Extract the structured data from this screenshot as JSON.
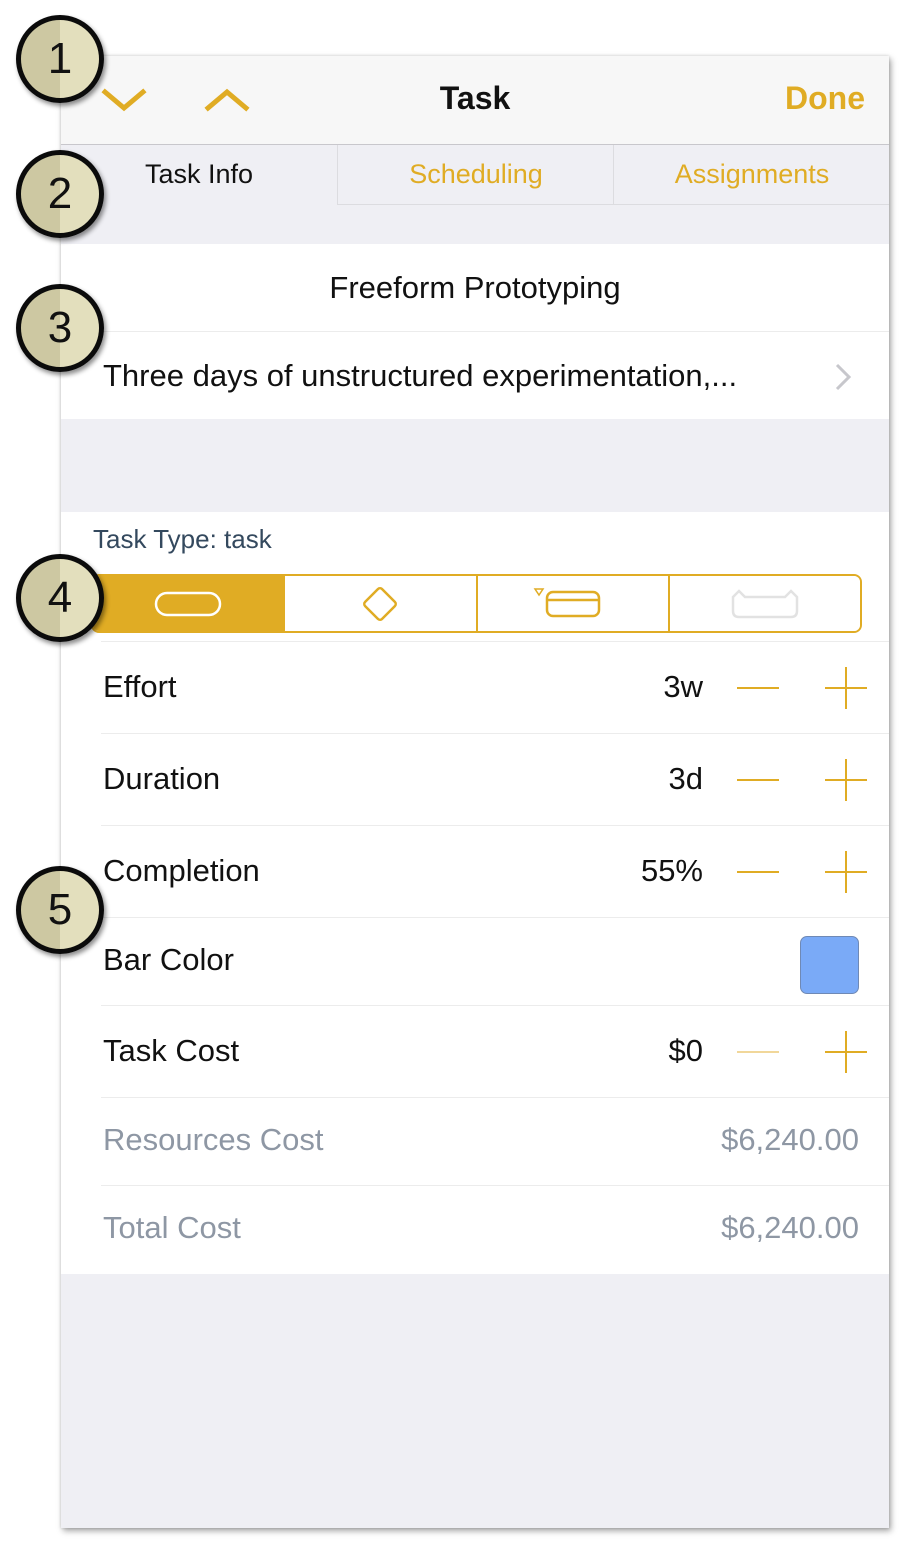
{
  "navbar": {
    "prev_icon": "chevron-down-icon",
    "next_icon": "chevron-up-icon",
    "title": "Task",
    "done_label": "Done"
  },
  "tabs": [
    {
      "label": "Task Info",
      "selected": true
    },
    {
      "label": "Scheduling",
      "selected": false
    },
    {
      "label": "Assignments",
      "selected": false
    }
  ],
  "task": {
    "title": "Freeform Prototyping",
    "notes": "Three days of unstructured experimentation,..."
  },
  "task_type": {
    "label": "Task Type: task",
    "options": [
      {
        "name": "task",
        "icon": "task-bar-icon",
        "selected": true
      },
      {
        "name": "milestone",
        "icon": "milestone-diamond-icon",
        "selected": false
      },
      {
        "name": "group",
        "icon": "group-bar-icon",
        "selected": false
      },
      {
        "name": "hammock",
        "icon": "hammock-icon",
        "selected": false,
        "disabled": true
      }
    ]
  },
  "fields": {
    "effort": {
      "label": "Effort",
      "value": "3w"
    },
    "duration": {
      "label": "Duration",
      "value": "3d"
    },
    "completion": {
      "label": "Completion",
      "value": "55%"
    },
    "bar_color": {
      "label": "Bar Color",
      "color": "#7aaaf7"
    },
    "task_cost": {
      "label": "Task Cost",
      "value": "$0",
      "minus_disabled": true
    },
    "resources_cost": {
      "label": "Resources Cost",
      "value": "$6,240.00"
    },
    "total_cost": {
      "label": "Total Cost",
      "value": "$6,240.00"
    }
  },
  "colors": {
    "accent": "#e0ac24",
    "muted_text": "#8e97a4",
    "background": "#efeff4"
  },
  "callouts": [
    "1",
    "2",
    "3",
    "4",
    "5"
  ]
}
